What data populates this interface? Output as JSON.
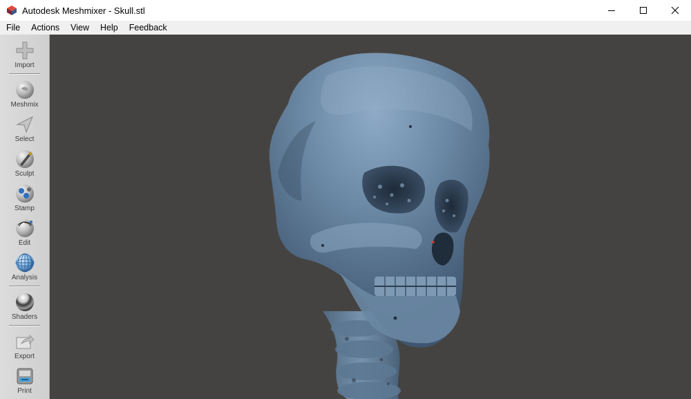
{
  "window": {
    "title": "Autodesk Meshmixer - Skull.stl",
    "controls": [
      "minimize-icon",
      "maximize-icon",
      "close-icon"
    ]
  },
  "menu": {
    "items": [
      "File",
      "Actions",
      "View",
      "Help",
      "Feedback"
    ]
  },
  "toolbar": {
    "tools": [
      {
        "label": "Import",
        "icon": "plus-icon"
      },
      {
        "label": "Meshmix",
        "icon": "meshmix-ball-icon"
      },
      {
        "label": "Select",
        "icon": "arrow-cursor-icon"
      },
      {
        "label": "Sculpt",
        "icon": "brush-ball-icon"
      },
      {
        "label": "Stamp",
        "icon": "stamp-ball-icon"
      },
      {
        "label": "Edit",
        "icon": "edit-ball-icon"
      },
      {
        "label": "Analysis",
        "icon": "wireframe-sphere-icon"
      },
      {
        "label": "Shaders",
        "icon": "chrome-sphere-icon"
      },
      {
        "label": "Export",
        "icon": "export-arrow-icon"
      },
      {
        "label": "Print",
        "icon": "printer-icon"
      }
    ]
  },
  "viewport": {
    "background": "#454341",
    "model": "skull-model",
    "model_color": "#6b88a4"
  }
}
